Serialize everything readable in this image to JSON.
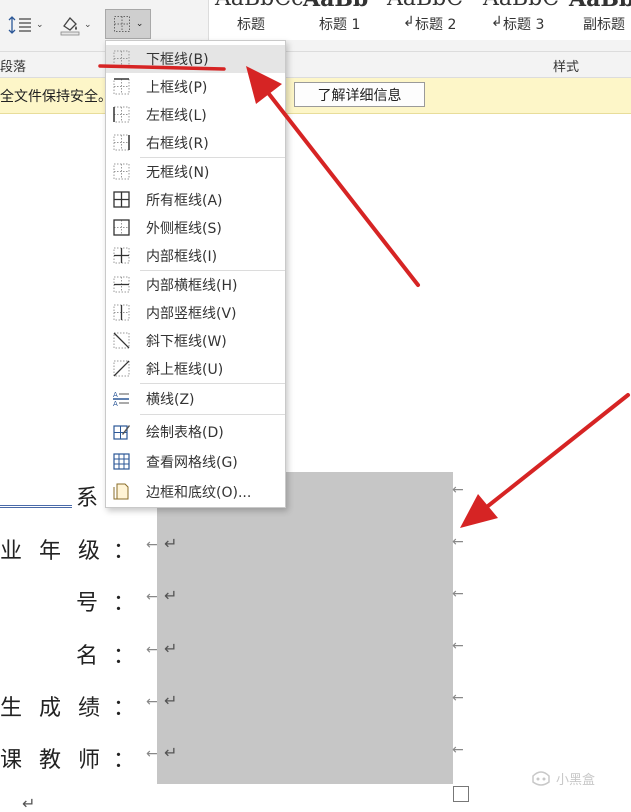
{
  "ribbon": {
    "style_gallery": [
      {
        "preview": "AaBbCc",
        "name": "标题"
      },
      {
        "preview": "AaBb",
        "name": "标题 1"
      },
      {
        "preview": "AaBbC",
        "name": "标题 2"
      },
      {
        "preview": "AaBbC",
        "name": "标题 3"
      },
      {
        "preview": "AaBb",
        "name": "副标题"
      }
    ],
    "paragraph_group_label": "段落",
    "styles_group_label": "样式",
    "icons": [
      "line-spacing-icon",
      "shading-icon",
      "borders-icon",
      "chevron-down-icon"
    ]
  },
  "message_bar": {
    "text": "全文件保持安全。",
    "button_label": "了解详细信息"
  },
  "border_menu": {
    "items": [
      {
        "label": "下框线(B)",
        "icon": "bottom-border-icon"
      },
      {
        "label": "上框线(P)",
        "icon": "top-border-icon"
      },
      {
        "label": "左框线(L)",
        "icon": "left-border-icon"
      },
      {
        "label": "右框线(R)",
        "icon": "right-border-icon"
      },
      {
        "label": "无框线(N)",
        "icon": "no-border-icon"
      },
      {
        "label": "所有框线(A)",
        "icon": "all-borders-icon"
      },
      {
        "label": "外侧框线(S)",
        "icon": "outside-borders-icon"
      },
      {
        "label": "内部框线(I)",
        "icon": "inside-borders-icon"
      },
      {
        "label": "内部横框线(H)",
        "icon": "inside-horizontal-border-icon"
      },
      {
        "label": "内部竖框线(V)",
        "icon": "inside-vertical-border-icon"
      },
      {
        "label": "斜下框线(W)",
        "icon": "diagonal-down-border-icon"
      },
      {
        "label": "斜上框线(U)",
        "icon": "diagonal-up-border-icon"
      },
      {
        "label": "横线(Z)",
        "icon": "horizontal-line-icon"
      },
      {
        "label": "绘制表格(D)",
        "icon": "draw-table-icon"
      },
      {
        "label": "查看网格线(G)",
        "icon": "view-gridlines-icon"
      },
      {
        "label": "边框和底纹(O)...",
        "icon": "borders-and-shading-icon"
      }
    ]
  },
  "document": {
    "rows": [
      {
        "label": "系",
        "colon": ""
      },
      {
        "label": "业年级",
        "colon": "："
      },
      {
        "label": "号",
        "colon": "："
      },
      {
        "label": "名",
        "colon": "："
      },
      {
        "label": "生成绩",
        "colon": "："
      },
      {
        "label": "课教师",
        "colon": "："
      }
    ],
    "paragraph_mark": "↵",
    "cell_mark": "←"
  },
  "watermark": "小黑盒",
  "colors": {
    "annotation_arrow": "#d62424",
    "message_bar_bg": "#fdf6c8",
    "table_cell_shading": "#c6c6c6",
    "menu_highlight": "#e5e5e5"
  }
}
